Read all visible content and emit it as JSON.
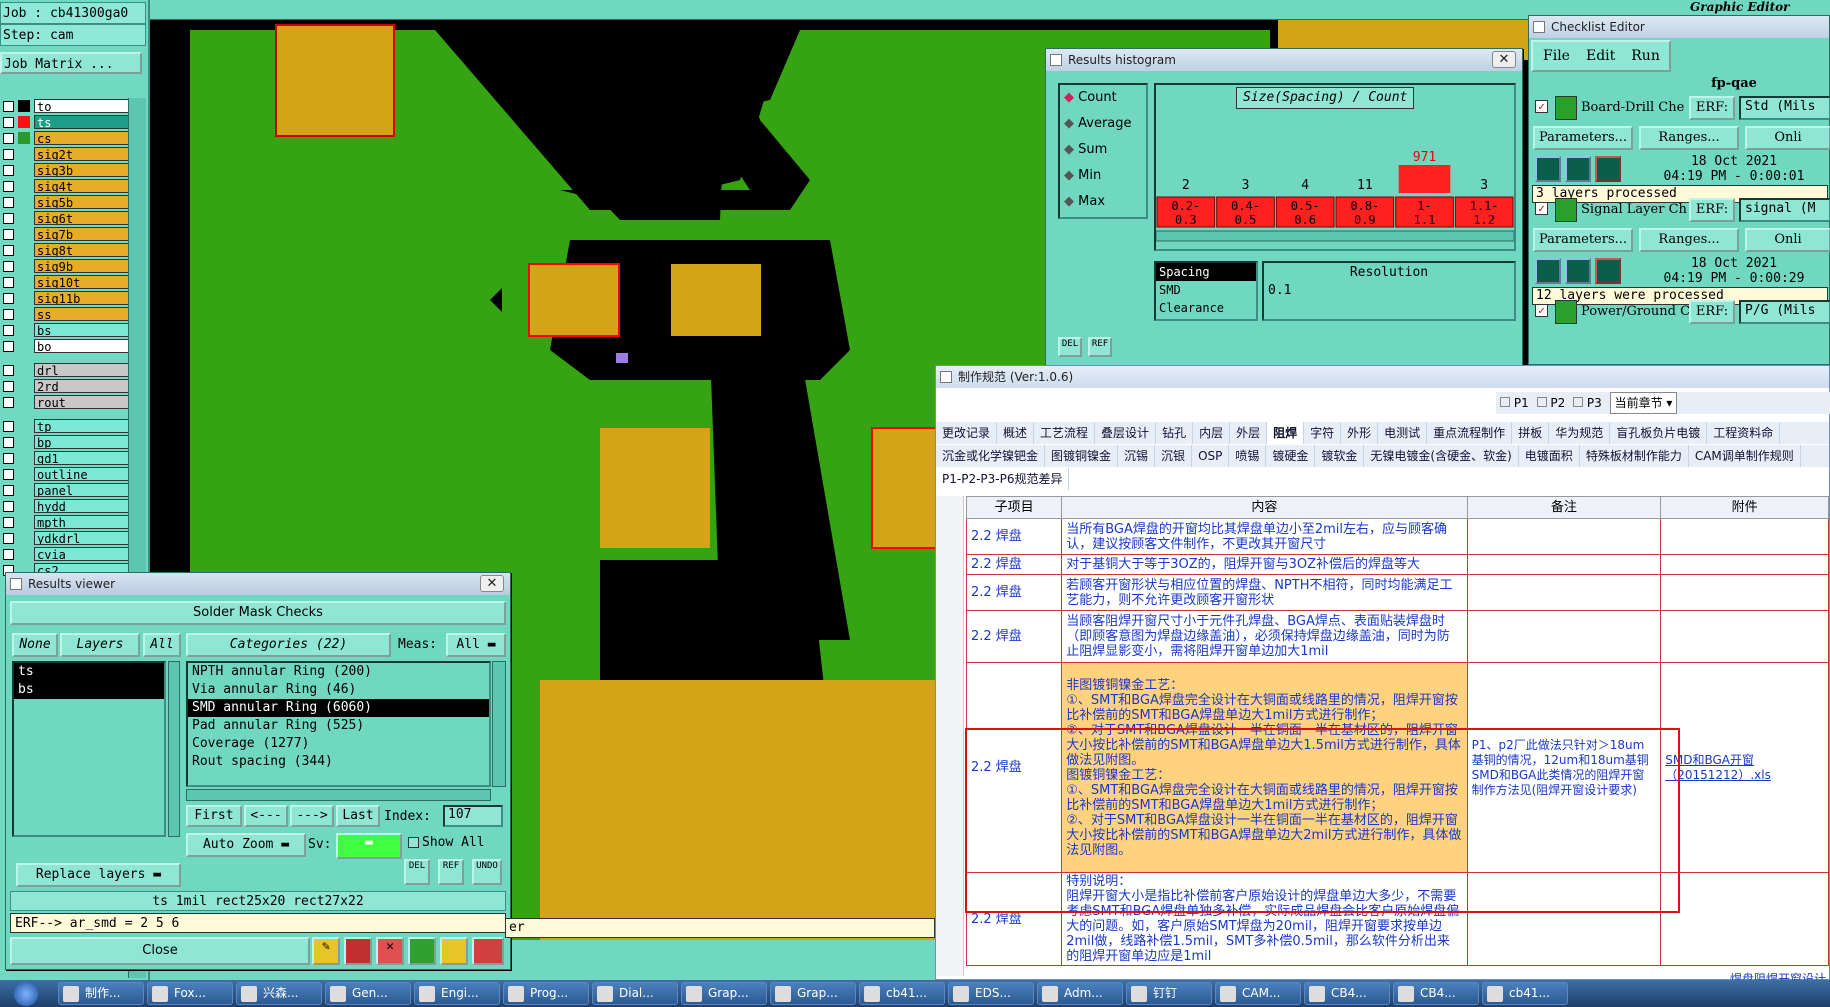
{
  "job": {
    "job_line": "Job : cb41300ga0",
    "step_line": "Step: cam",
    "matrix_label": "Job Matrix ..."
  },
  "layers_group1": [
    {
      "name": "to",
      "color": "#000000",
      "style": "top"
    },
    {
      "name": "ts",
      "color": "#ff1010",
      "style": "sel"
    },
    {
      "name": "cs",
      "color": "#2a9a2a",
      "style": "sig"
    },
    {
      "name": "sig2t",
      "color": "",
      "style": "sig"
    },
    {
      "name": "sig3b",
      "color": "",
      "style": "sig"
    },
    {
      "name": "sig4t",
      "color": "",
      "style": "sig"
    },
    {
      "name": "sig5b",
      "color": "",
      "style": "sig"
    },
    {
      "name": "sig6t",
      "color": "",
      "style": "sig"
    },
    {
      "name": "sig7b",
      "color": "",
      "style": "sig"
    },
    {
      "name": "sig8t",
      "color": "",
      "style": "sig"
    },
    {
      "name": "sig9b",
      "color": "",
      "style": "sig"
    },
    {
      "name": "sig10t",
      "color": "",
      "style": "sig"
    },
    {
      "name": "sig11b",
      "color": "",
      "style": "sig"
    },
    {
      "name": "ss",
      "color": "",
      "style": "sig"
    },
    {
      "name": "bs",
      "color": "",
      "style": "cyan"
    },
    {
      "name": "bo",
      "color": "",
      "style": "top"
    }
  ],
  "layers_group2": [
    {
      "name": "drl",
      "style": "drl"
    },
    {
      "name": "2rd",
      "style": "drl"
    },
    {
      "name": "rout",
      "style": "drl"
    }
  ],
  "layers_group3": [
    {
      "name": "tp"
    },
    {
      "name": "bp"
    },
    {
      "name": "gd1"
    },
    {
      "name": "outline"
    },
    {
      "name": "panel"
    },
    {
      "name": "hydd"
    },
    {
      "name": "mpth"
    },
    {
      "name": "ydkdrl"
    },
    {
      "name": "cvia"
    },
    {
      "name": "cs2"
    }
  ],
  "results_viewer": {
    "title": "Results viewer",
    "header": "Solder Mask Checks",
    "none_btn": "None",
    "layers_btn": "Layers",
    "all_btn": "All",
    "categories_label": "Categories (22)",
    "meas_label": "Meas:",
    "meas_value": "All",
    "layers": [
      "ts",
      "bs"
    ],
    "categories": [
      "NPTH annular Ring (200)",
      "Via annular Ring (46)",
      "SMD annular Ring (6060)",
      "Pad annular Ring (525)",
      "Coverage (1277)",
      "Rout spacing (344)"
    ],
    "first": "First",
    "prev": "<---",
    "next": "--->",
    "last": "Last",
    "index_label": "Index:",
    "index_value": "107",
    "auto_zoom": "Auto Zoom",
    "sv": "Sv:",
    "show_all": "Show All",
    "replace": "Replace layers",
    "info": "ts  1mil   rect25x20   rect27x22",
    "erf": "ERF--> ar_smd = 2 5 6",
    "close": "Close"
  },
  "histogram": {
    "title": "Results histogram",
    "header": "Size(Spacing) / Count",
    "options": [
      "Count",
      "Average",
      "Sum",
      "Min",
      "Max"
    ],
    "counts": [
      "2",
      "3",
      "4",
      "11",
      "971",
      "3"
    ],
    "bins": [
      "0.2-\n0.3",
      "0.4-\n0.5",
      "0.5-\n0.6",
      "0.8-\n0.9",
      "1-\n1.1",
      "1.1-\n1.2"
    ],
    "types": [
      "Spacing",
      "SMD",
      "Clearance"
    ],
    "resolution_label": "Resolution",
    "resolution_value": "0.1",
    "del": "DEL",
    "ref": "REF"
  },
  "chart_data": {
    "type": "bar",
    "categories": [
      "0.2-0.3",
      "0.4-0.5",
      "0.5-0.6",
      "0.8-0.9",
      "1-1.1",
      "1.1-1.2"
    ],
    "values": [
      2,
      3,
      4,
      11,
      971,
      3
    ],
    "title": "Size(Spacing) / Count",
    "xlabel": "",
    "ylabel": ""
  },
  "checklist": {
    "title": "Checklist Editor",
    "menu": [
      "File",
      "Edit",
      "Run"
    ],
    "name": "fp-qae",
    "items": [
      {
        "name": "Board-Drill Che",
        "erf": "ERF:",
        "erf_val": "Std (Mils",
        "params": "Parameters...",
        "ranges": "Ranges...",
        "online": "Onli",
        "date": "18 Oct 2021",
        "time": "04:19 PM - 0:00:01",
        "status": "3 layers processed"
      },
      {
        "name": "Signal Layer Ch",
        "erf": "ERF:",
        "erf_val": "signal (M",
        "params": "Parameters...",
        "ranges": "Ranges...",
        "online": "Onli",
        "date": "18 Oct 2021",
        "time": "04:19 PM - 0:00:29",
        "status": "12 layers were processed"
      },
      {
        "name": "Power/Ground C",
        "erf": "ERF:",
        "erf_val": "P/G (Mils"
      }
    ]
  },
  "editor_header": {
    "title": "Graphic Editor"
  },
  "doc": {
    "title": "制作规范 (Ver:1.0.6)",
    "p1": "P1",
    "p2": "P2",
    "p3": "P3",
    "section": "当前章节",
    "tabs1": [
      "更改记录",
      "概述",
      "工艺流程",
      "叠层设计",
      "钻孔",
      "内层",
      "外层",
      "阻焊",
      "字符",
      "外形",
      "电测试",
      "重点流程制作",
      "拼板",
      "华为规范",
      "盲孔板负片电镀",
      "工程资料命"
    ],
    "tabs2": [
      "沉金或化学镍钯金",
      "图镀铜镍金",
      "沉锡",
      "沉银",
      "OSP",
      "喷锡",
      "镀硬金",
      "镀软金",
      "无镍电镀金(含硬金、软金)",
      "电镀面积",
      "特殊板材制作能力",
      "CAM调单制作规则"
    ],
    "tab3": "P1-P2-P3-P6规范差异",
    "headers": [
      "子项目",
      "内容",
      "备注",
      "附件"
    ],
    "rows": [
      {
        "sub": "2.2 焊盘",
        "content": "当所有BGA焊盘的开窗均比其焊盘单边小至2mil左右，应与顾客确认，建议按顾客文件制作，不更改其开窗尺寸",
        "note": "",
        "att": ""
      },
      {
        "sub": "2.2 焊盘",
        "content": "对于基铜大于等于3OZ的，阻焊开窗与3OZ补偿后的焊盘等大",
        "note": "",
        "att": ""
      },
      {
        "sub": "2.2 焊盘",
        "content": "若顾客开窗形状与相应位置的焊盘、NPTH不相符，同时均能满足工艺能力，则不允许更改顾客开窗形状",
        "note": "",
        "att": ""
      },
      {
        "sub": "2.2 焊盘",
        "content": "当顾客阻焊开窗尺寸小于元件孔焊盘、BGA焊点、表面贴装焊盘时（即顾客意图为焊盘边缘盖油），必须保持焊盘边缘盖油，同时为防止阻焊显影变小，需将阻焊开窗单边加大1mil",
        "note": "",
        "att": ""
      },
      {
        "sub": "2.2 焊盘",
        "content": "非图镀铜镍金工艺：\n①、SMT和BGA焊盘完全设计在大铜面或线路里的情况，阻焊开窗按 比补偿前的SMT和BGA焊盘单边大1mil方式进行制作；\n②、对于SMT和BGA焊盘设计一半在铜面一半在基材区的，阻焊开窗大小按比补偿前的SMT和BGA焊盘单边大1.5mil方式进行制作，具体做法见附图。\n图镀铜镍金工艺：\n①、SMT和BGA焊盘完全设计在大铜面或线路里的情况，阻焊开窗按 比补偿前的SMT和BGA焊盘单边大1mil方式进行制作；\n②、对于SMT和BGA焊盘设计一半在铜面一半在基材区的，阻焊开窗大小按比补偿前的SMT和BGA焊盘单边大2mil方式进行制作，具体做法见附图。",
        "note": "P1、p2厂此做法只针对＞18um基铜的情况，12um和18um基铜SMD和BGA此类情况的阻焊开窗制作方法见(阻焊开窗设计要求)",
        "att": "SMD和BGA开窗（20151212）.xls"
      },
      {
        "sub": "2.2 焊盘",
        "content": "特别说明：\n阻焊开窗大小是指比补偿前客户原始设计的焊盘单边大多少，不需要考虑SMT和BGA焊盘单独多补偿，实际成品焊盘会比客户原始焊盘偏大的问题。如，客户原始SMT焊盘为20mil，阻焊开窗要求按单边2mil做，线路补偿1.5mil，SMT多补偿0.5mil，那么软件分析出来的阻焊开窗单边应是1mil",
        "note": "",
        "att": ""
      }
    ],
    "bottom_link": "焊盘阻焊开窗设计"
  },
  "message": "er",
  "taskbar": [
    "制作...",
    "Fox...",
    "兴森...",
    "Gen...",
    "Engi...",
    "Prog...",
    "Dial...",
    "Grap...",
    "Grap...",
    "cb41...",
    "EDS...",
    "Adm...",
    "钉钉",
    "CAM...",
    "CB4...",
    "CB4...",
    "cb41..."
  ]
}
